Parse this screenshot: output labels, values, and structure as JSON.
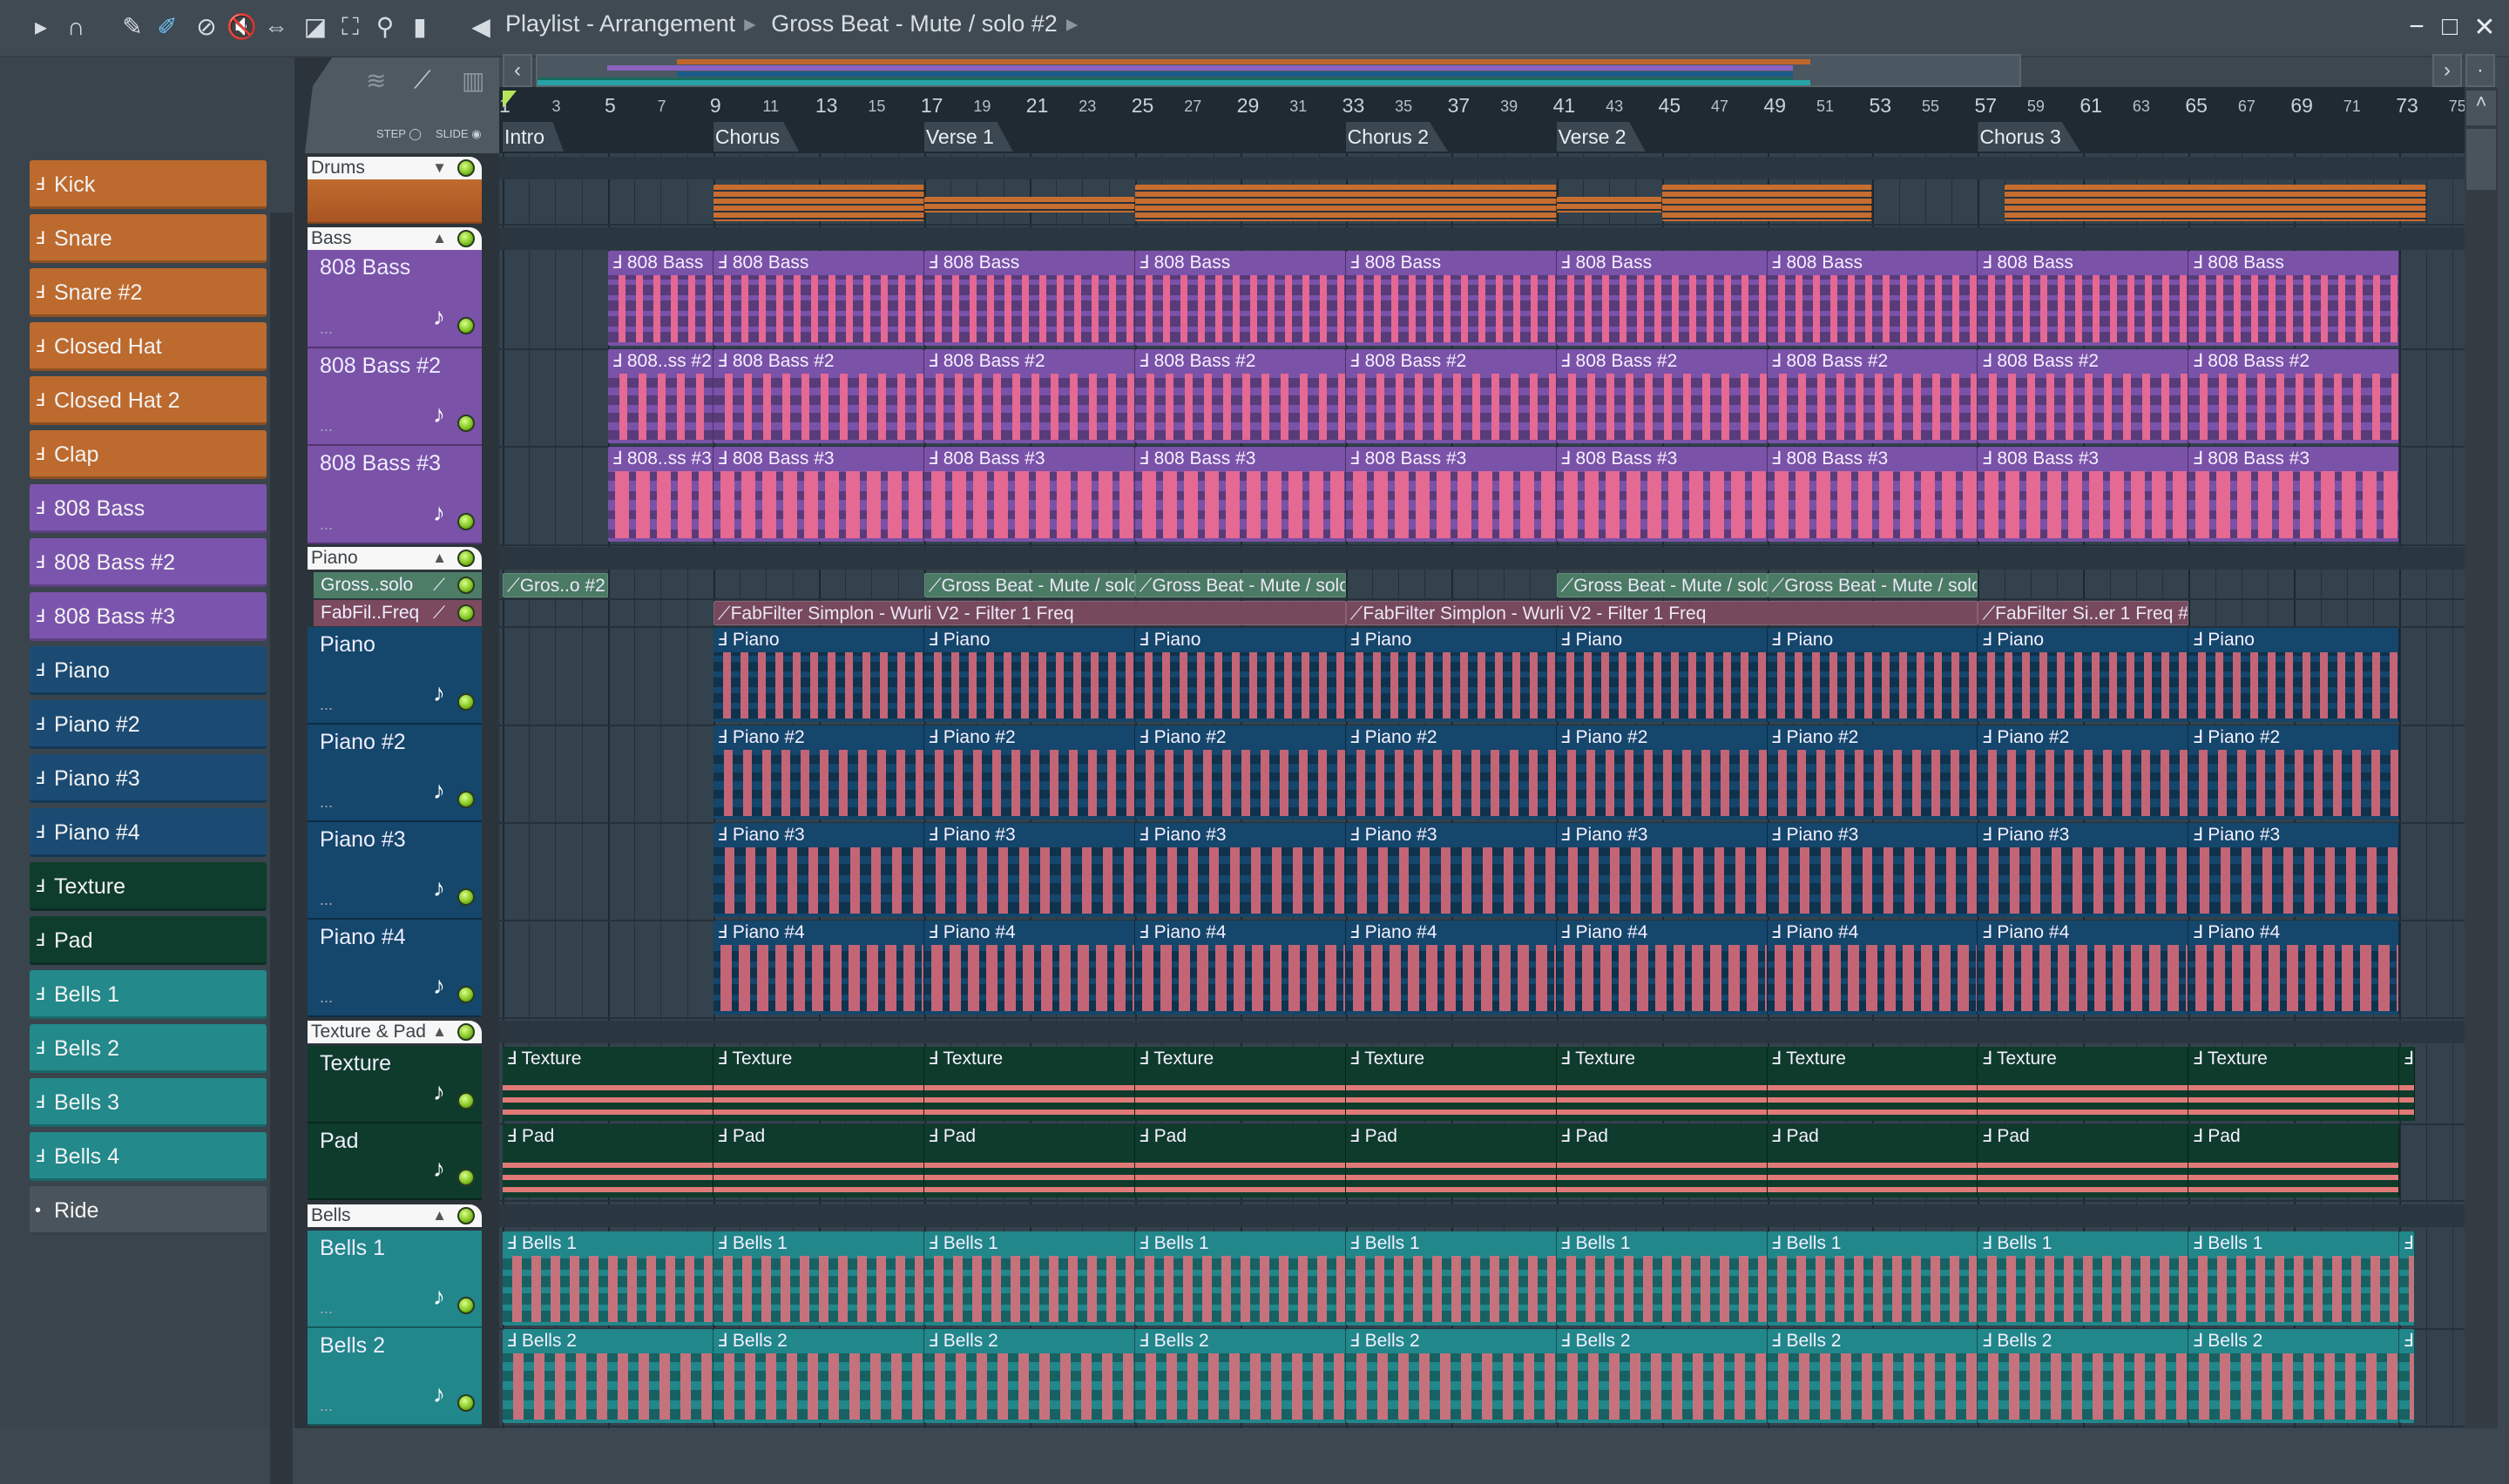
{
  "titlebar": {
    "breadcrumb": [
      "Playlist - Arrangement",
      "Gross Beat - Mute / solo #2"
    ],
    "tools": [
      "play-arrow-icon",
      "magnet-snap-icon",
      "pencil-icon",
      "paint-brush-icon",
      "delete-icon",
      "mute-icon",
      "slip-icon",
      "slice-icon",
      "select-icon",
      "zoom-icon",
      "playback-icon",
      "speaker-icon"
    ],
    "window": [
      "minimize",
      "maximize",
      "close"
    ]
  },
  "left_panel": {
    "step_label": "STEP",
    "slide_label": "SLIDE",
    "items": [
      {
        "label": "Kick",
        "color": "#bd6a2e"
      },
      {
        "label": "Snare",
        "color": "#bd6a2e"
      },
      {
        "label": "Snare  #2",
        "color": "#bd6a2e"
      },
      {
        "label": "Closed Hat",
        "color": "#bd6a2e"
      },
      {
        "label": "Closed Hat 2",
        "color": "#bd6a2e"
      },
      {
        "label": "Clap",
        "color": "#bd6a2e"
      },
      {
        "label": "808 Bass",
        "color": "#7b55ad"
      },
      {
        "label": "808 Bass #2",
        "color": "#7b55ad"
      },
      {
        "label": "808 Bass #3",
        "color": "#7b55ad"
      },
      {
        "label": "Piano",
        "color": "#1b4b73"
      },
      {
        "label": "Piano #2",
        "color": "#1b4b73"
      },
      {
        "label": "Piano #3",
        "color": "#1b4b73"
      },
      {
        "label": "Piano #4",
        "color": "#1b4b73"
      },
      {
        "label": "Texture",
        "color": "#0f3d2d"
      },
      {
        "label": "Pad",
        "color": "#0f3d2d"
      },
      {
        "label": "Bells 1",
        "color": "#23898b"
      },
      {
        "label": "Bells 2",
        "color": "#23898b"
      },
      {
        "label": "Bells 3",
        "color": "#23898b"
      },
      {
        "label": "Bells 4",
        "color": "#23898b"
      },
      {
        "label": "Ride",
        "color": "#4a545c"
      }
    ]
  },
  "ruler": {
    "ticks": [
      1,
      3,
      5,
      7,
      9,
      11,
      13,
      15,
      17,
      19,
      21,
      23,
      25,
      27,
      29,
      31,
      33,
      35,
      37,
      39,
      41,
      43,
      45,
      47,
      49,
      51,
      53,
      55,
      57,
      59,
      61,
      63,
      65,
      67,
      69,
      71,
      73,
      75
    ],
    "markers": [
      {
        "label": "Intro",
        "bar": 1
      },
      {
        "label": "Chorus",
        "bar": 9
      },
      {
        "label": "Verse 1",
        "bar": 17
      },
      {
        "label": "Chorus 2",
        "bar": 33
      },
      {
        "label": "Verse 2",
        "bar": 41
      },
      {
        "label": "Chorus 3",
        "bar": 57
      }
    ]
  },
  "groups": [
    {
      "name": "Drums"
    },
    {
      "name": "Bass"
    },
    {
      "name": "Piano"
    },
    {
      "name": "Texture & Pad"
    },
    {
      "name": "Bells"
    }
  ],
  "tracks": [
    {
      "name": "",
      "group": 0,
      "kind": "drums",
      "color": "#c0652c",
      "clips": [
        {
          "s": 9,
          "e": 17
        },
        {
          "s": 17,
          "e": 25,
          "thin": true
        },
        {
          "s": 25,
          "e": 41
        },
        {
          "s": 41,
          "e": 45,
          "thin": true
        },
        {
          "s": 45,
          "e": 53
        },
        {
          "s": 58,
          "e": 74
        }
      ]
    },
    {
      "name": "808 Bass",
      "group": 1,
      "color": "#7a52a8",
      "clips": [
        {
          "label": "808 Bass",
          "s": 5,
          "e": 9
        },
        {
          "label": "808 Bass",
          "s": 9,
          "e": 17
        },
        {
          "label": "808 Bass",
          "s": 17,
          "e": 25
        },
        {
          "label": "808 Bass",
          "s": 25,
          "e": 33
        },
        {
          "label": "808 Bass",
          "s": 33,
          "e": 41
        },
        {
          "label": "808 Bass",
          "s": 41,
          "e": 49
        },
        {
          "label": "808 Bass",
          "s": 49,
          "e": 57
        },
        {
          "label": "808 Bass",
          "s": 57,
          "e": 65
        },
        {
          "label": "808 Bass",
          "s": 65,
          "e": 73
        }
      ]
    },
    {
      "name": "808 Bass #2",
      "group": 1,
      "color": "#7a52a8",
      "clips": [
        {
          "label": "808..ss #2",
          "s": 5,
          "e": 9
        },
        {
          "label": "808 Bass #2",
          "s": 9,
          "e": 17
        },
        {
          "label": "808 Bass #2",
          "s": 17,
          "e": 25
        },
        {
          "label": "808 Bass #2",
          "s": 25,
          "e": 33
        },
        {
          "label": "808 Bass #2",
          "s": 33,
          "e": 41
        },
        {
          "label": "808 Bass #2",
          "s": 41,
          "e": 49
        },
        {
          "label": "808 Bass #2",
          "s": 49,
          "e": 57
        },
        {
          "label": "808 Bass #2",
          "s": 57,
          "e": 65
        },
        {
          "label": "808 Bass #2",
          "s": 65,
          "e": 73
        }
      ]
    },
    {
      "name": "808 Bass #3",
      "group": 1,
      "color": "#7a52a8",
      "clips": [
        {
          "label": "808..ss #3",
          "s": 5,
          "e": 9
        },
        {
          "label": "808 Bass #3",
          "s": 9,
          "e": 17
        },
        {
          "label": "808 Bass #3",
          "s": 17,
          "e": 25
        },
        {
          "label": "808 Bass #3",
          "s": 25,
          "e": 33
        },
        {
          "label": "808 Bass #3",
          "s": 33,
          "e": 41
        },
        {
          "label": "808 Bass #3",
          "s": 41,
          "e": 49
        },
        {
          "label": "808 Bass #3",
          "s": 49,
          "e": 57
        },
        {
          "label": "808 Bass #3",
          "s": 57,
          "e": 65
        },
        {
          "label": "808 Bass #3",
          "s": 65,
          "e": 73
        }
      ]
    },
    {
      "name": "Gross..solo",
      "group": 2,
      "kind": "auto",
      "color": "#4d7d67",
      "clips": [
        {
          "label": "Gros..o #2",
          "s": 1,
          "e": 5
        },
        {
          "label": "Gross Beat - Mute / solo",
          "s": 17,
          "e": 25
        },
        {
          "label": "Gross Beat - Mute / solo",
          "s": 25,
          "e": 33
        },
        {
          "label": "Gross Beat - Mute / solo",
          "s": 41,
          "e": 49
        },
        {
          "label": "Gross Beat - Mute / solo",
          "s": 49,
          "e": 57
        }
      ]
    },
    {
      "name": "FabFil..Freq",
      "group": 2,
      "kind": "auto",
      "color": "#7b4a5e",
      "clips": [
        {
          "label": "FabFilter Simplon - Wurli V2 - Filter 1 Freq",
          "s": 9,
          "e": 33
        },
        {
          "label": "FabFilter Simplon - Wurli V2 - Filter 1 Freq",
          "s": 33,
          "e": 57
        },
        {
          "label": "FabFilter Si..er 1 Freq #2",
          "s": 57,
          "e": 65
        }
      ]
    },
    {
      "name": "Piano",
      "group": 2,
      "color": "#15466b",
      "clips": [
        {
          "label": "Piano",
          "s": 9,
          "e": 17
        },
        {
          "label": "Piano",
          "s": 17,
          "e": 25
        },
        {
          "label": "Piano",
          "s": 25,
          "e": 33
        },
        {
          "label": "Piano",
          "s": 33,
          "e": 41
        },
        {
          "label": "Piano",
          "s": 41,
          "e": 49
        },
        {
          "label": "Piano",
          "s": 49,
          "e": 57
        },
        {
          "label": "Piano",
          "s": 57,
          "e": 65
        },
        {
          "label": "Piano",
          "s": 65,
          "e": 73
        }
      ]
    },
    {
      "name": "Piano #2",
      "group": 2,
      "color": "#15466b",
      "clips": [
        {
          "label": "Piano #2",
          "s": 9,
          "e": 17
        },
        {
          "label": "Piano #2",
          "s": 17,
          "e": 25
        },
        {
          "label": "Piano #2",
          "s": 25,
          "e": 33
        },
        {
          "label": "Piano #2",
          "s": 33,
          "e": 41
        },
        {
          "label": "Piano #2",
          "s": 41,
          "e": 49
        },
        {
          "label": "Piano #2",
          "s": 49,
          "e": 57
        },
        {
          "label": "Piano #2",
          "s": 57,
          "e": 65
        },
        {
          "label": "Piano #2",
          "s": 65,
          "e": 73
        }
      ]
    },
    {
      "name": "Piano #3",
      "group": 2,
      "color": "#15466b",
      "clips": [
        {
          "label": "Piano #3",
          "s": 9,
          "e": 17
        },
        {
          "label": "Piano #3",
          "s": 17,
          "e": 25
        },
        {
          "label": "Piano #3",
          "s": 25,
          "e": 33
        },
        {
          "label": "Piano #3",
          "s": 33,
          "e": 41
        },
        {
          "label": "Piano #3",
          "s": 41,
          "e": 49
        },
        {
          "label": "Piano #3",
          "s": 49,
          "e": 57
        },
        {
          "label": "Piano #3",
          "s": 57,
          "e": 65
        },
        {
          "label": "Piano #3",
          "s": 65,
          "e": 73
        }
      ]
    },
    {
      "name": "Piano #4",
      "group": 2,
      "color": "#15466b",
      "clips": [
        {
          "label": "Piano #4",
          "s": 9,
          "e": 17
        },
        {
          "label": "Piano #4",
          "s": 17,
          "e": 25
        },
        {
          "label": "Piano #4",
          "s": 25,
          "e": 33
        },
        {
          "label": "Piano #4",
          "s": 33,
          "e": 41
        },
        {
          "label": "Piano #4",
          "s": 41,
          "e": 49
        },
        {
          "label": "Piano #4",
          "s": 49,
          "e": 57
        },
        {
          "label": "Piano #4",
          "s": 57,
          "e": 65
        },
        {
          "label": "Piano #4",
          "s": 65,
          "e": 73
        }
      ]
    },
    {
      "name": "Texture",
      "group": 3,
      "color": "#0e3b2b",
      "clips": [
        {
          "label": "Texture",
          "s": 1,
          "e": 9
        },
        {
          "label": "Texture",
          "s": 9,
          "e": 17
        },
        {
          "label": "Texture",
          "s": 17,
          "e": 25
        },
        {
          "label": "Texture",
          "s": 25,
          "e": 33
        },
        {
          "label": "Texture",
          "s": 33,
          "e": 41
        },
        {
          "label": "Texture",
          "s": 41,
          "e": 49
        },
        {
          "label": "Texture",
          "s": 49,
          "e": 57
        },
        {
          "label": "Texture",
          "s": 57,
          "e": 65
        },
        {
          "label": "Texture",
          "s": 65,
          "e": 73
        },
        {
          "label": "",
          "s": 73,
          "e": 73.6
        }
      ]
    },
    {
      "name": "Pad",
      "group": 3,
      "color": "#0e3b2b",
      "clips": [
        {
          "label": "Pad",
          "s": 1,
          "e": 9
        },
        {
          "label": "Pad",
          "s": 9,
          "e": 17
        },
        {
          "label": "Pad",
          "s": 17,
          "e": 25
        },
        {
          "label": "Pad",
          "s": 25,
          "e": 33
        },
        {
          "label": "Pad",
          "s": 33,
          "e": 41
        },
        {
          "label": "Pad",
          "s": 41,
          "e": 49
        },
        {
          "label": "Pad",
          "s": 49,
          "e": 57
        },
        {
          "label": "Pad",
          "s": 57,
          "e": 65
        },
        {
          "label": "Pad",
          "s": 65,
          "e": 73
        }
      ]
    },
    {
      "name": "Bells 1",
      "group": 4,
      "color": "#21878a",
      "clips": [
        {
          "label": "Bells 1",
          "s": 1,
          "e": 9
        },
        {
          "label": "Bells 1",
          "s": 9,
          "e": 17
        },
        {
          "label": "Bells 1",
          "s": 17,
          "e": 25
        },
        {
          "label": "Bells 1",
          "s": 25,
          "e": 33
        },
        {
          "label": "Bells 1",
          "s": 33,
          "e": 41
        },
        {
          "label": "Bells 1",
          "s": 41,
          "e": 49
        },
        {
          "label": "Bells 1",
          "s": 49,
          "e": 57
        },
        {
          "label": "Bells 1",
          "s": 57,
          "e": 65
        },
        {
          "label": "Bells 1",
          "s": 65,
          "e": 73
        },
        {
          "label": "",
          "s": 73,
          "e": 73.6
        }
      ]
    },
    {
      "name": "Bells 2",
      "group": 4,
      "color": "#21878a",
      "clips": [
        {
          "label": "Bells 2",
          "s": 1,
          "e": 9
        },
        {
          "label": "Bells 2",
          "s": 9,
          "e": 17
        },
        {
          "label": "Bells 2",
          "s": 17,
          "e": 25
        },
        {
          "label": "Bells 2",
          "s": 25,
          "e": 33
        },
        {
          "label": "Bells 2",
          "s": 33,
          "e": 41
        },
        {
          "label": "Bells 2",
          "s": 41,
          "e": 49
        },
        {
          "label": "Bells 2",
          "s": 49,
          "e": 57
        },
        {
          "label": "Bells 2",
          "s": 57,
          "e": 65
        },
        {
          "label": "Bells 2",
          "s": 65,
          "e": 73
        },
        {
          "label": "",
          "s": 73,
          "e": 73.6
        }
      ]
    }
  ]
}
